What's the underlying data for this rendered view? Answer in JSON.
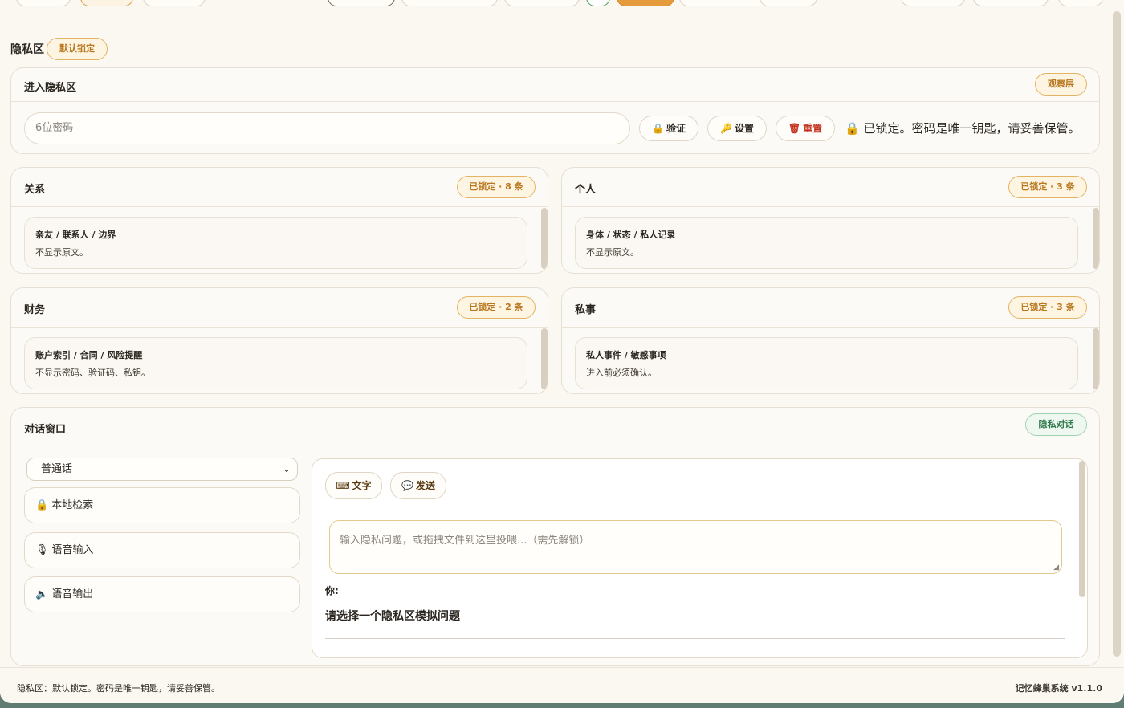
{
  "section": {
    "title": "隐私区",
    "badge": "默认锁定"
  },
  "unlock": {
    "title": "进入隐私区",
    "badge": "观察层",
    "password_placeholder": "6位密码",
    "verify_label": "验证",
    "settings_label": "设置",
    "reset_label": "重置",
    "status_text": "已锁定。密码是唯一钥匙，请妥善保管。"
  },
  "categories": [
    {
      "title": "关系",
      "badge": "已锁定 · 8 条",
      "item_title": "亲友 / 联系人 / 边界",
      "item_desc": "不显示原文。"
    },
    {
      "title": "个人",
      "badge": "已锁定 · 3 条",
      "item_title": "身体 / 状态 / 私人记录",
      "item_desc": "不显示原文。"
    },
    {
      "title": "财务",
      "badge": "已锁定 · 2 条",
      "item_title": "账户索引 / 合同 / 风险提醒",
      "item_desc": "不显示密码、验证码、私钥。"
    },
    {
      "title": "私事",
      "badge": "已锁定 · 3 条",
      "item_title": "私人事件 / 敏感事项",
      "item_desc": "进入前必须确认。"
    }
  ],
  "chat": {
    "title": "对话窗口",
    "badge": "隐私对话",
    "language_selected": "普通话",
    "local_search_label": "本地检索",
    "voice_input_label": "语音输入",
    "voice_output_label": "语音输出",
    "text_mode_label": "文字",
    "send_label": "发送",
    "input_placeholder": "输入隐私问题，或拖拽文件到这里投喂...（需先解锁）",
    "you_label": "你:",
    "you_message": "请选择一个隐私区模拟问题"
  },
  "footer": {
    "left_text": "隐私区：默认锁定。密码是唯一钥匙，请妥善保管。",
    "right_text": "记忆蜂巢系统 v1.1.0"
  },
  "colors": {
    "accent": "#d79a3a",
    "danger": "#c4301e",
    "success": "#2f7a4a",
    "background": "#fbf8f2"
  }
}
